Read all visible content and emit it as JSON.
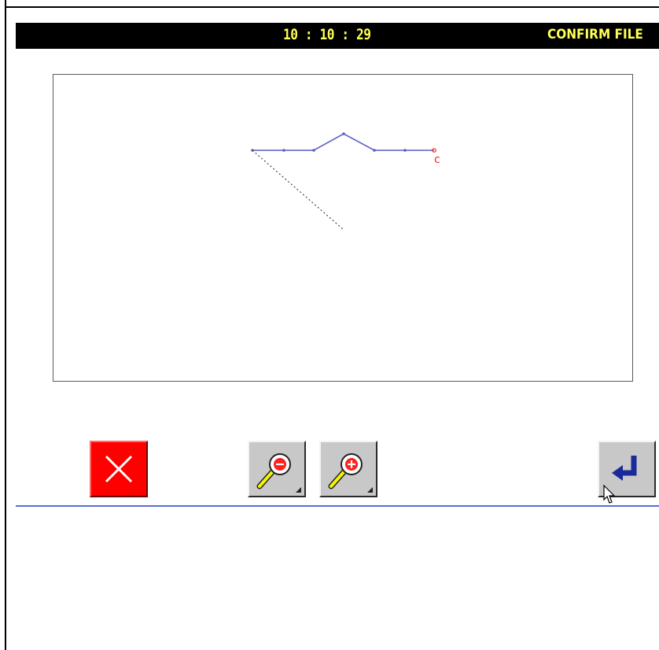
{
  "header": {
    "clock": "10 : 10 : 29",
    "screen_title": "CONFIRM FILE"
  },
  "preview": {
    "start_marker": "c",
    "stitch_color": "#5a5fc8",
    "marker_color": "#ff2020"
  },
  "toolbar": {
    "cancel_icon": "close-icon",
    "zoom_out_icon": "zoom-out-icon",
    "zoom_in_icon": "zoom-in-icon",
    "enter_icon": "enter-icon"
  },
  "colors": {
    "title_bar": "#000000",
    "title_text": "#ffff55",
    "cancel_button": "#ff0000",
    "separator": "#5b6bd6"
  }
}
